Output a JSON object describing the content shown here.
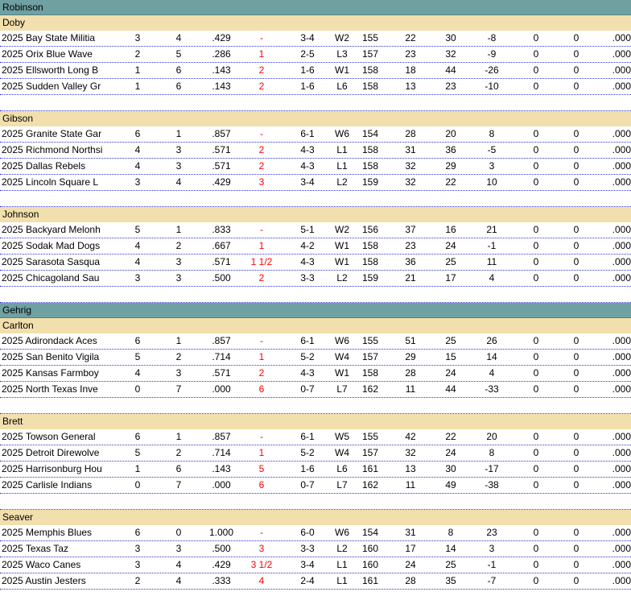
{
  "conferences": [
    {
      "name": "Robinson",
      "divisions": [
        {
          "name": "Doby",
          "teams": [
            {
              "team": "2025 Bay State Militia",
              "w": "3",
              "l": "4",
              "pct": ".429",
              "gb": "-",
              "div": "3-4",
              "strk": "W2",
              "rem": "155",
              "rf": "22",
              "ra": "30",
              "diff": "-8",
              "a": "0",
              "b": "0",
              "c": ".000"
            },
            {
              "team": "2025 Orix  Blue Wave",
              "w": "2",
              "l": "5",
              "pct": ".286",
              "gb": "1",
              "div": "2-5",
              "strk": "L3",
              "rem": "157",
              "rf": "23",
              "ra": "32",
              "diff": "-9",
              "a": "0",
              "b": "0",
              "c": ".000"
            },
            {
              "team": "2025 Ellsworth Long B",
              "w": "1",
              "l": "6",
              "pct": ".143",
              "gb": "2",
              "div": "1-6",
              "strk": "W1",
              "rem": "158",
              "rf": "18",
              "ra": "44",
              "diff": "-26",
              "a": "0",
              "b": "0",
              "c": ".000"
            },
            {
              "team": "2025 Sudden Valley Gr",
              "w": "1",
              "l": "6",
              "pct": ".143",
              "gb": "2",
              "div": "1-6",
              "strk": "L6",
              "rem": "158",
              "rf": "13",
              "ra": "23",
              "diff": "-10",
              "a": "0",
              "b": "0",
              "c": ".000"
            }
          ]
        },
        {
          "name": "Gibson",
          "teams": [
            {
              "team": "2025 Granite State Gar",
              "w": "6",
              "l": "1",
              "pct": ".857",
              "gb": "-",
              "div": "6-1",
              "strk": "W6",
              "rem": "154",
              "rf": "28",
              "ra": "20",
              "diff": "8",
              "a": "0",
              "b": "0",
              "c": ".000"
            },
            {
              "team": "2025 Richmond Northsi",
              "w": "4",
              "l": "3",
              "pct": ".571",
              "gb": "2",
              "div": "4-3",
              "strk": "L1",
              "rem": "158",
              "rf": "31",
              "ra": "36",
              "diff": "-5",
              "a": "0",
              "b": "0",
              "c": ".000"
            },
            {
              "team": "2025 Dallas Rebels",
              "w": "4",
              "l": "3",
              "pct": ".571",
              "gb": "2",
              "div": "4-3",
              "strk": "L1",
              "rem": "158",
              "rf": "32",
              "ra": "29",
              "diff": "3",
              "a": "0",
              "b": "0",
              "c": ".000"
            },
            {
              "team": "2025 Lincoln Square L",
              "w": "3",
              "l": "4",
              "pct": ".429",
              "gb": "3",
              "div": "3-4",
              "strk": "L2",
              "rem": "159",
              "rf": "32",
              "ra": "22",
              "diff": "10",
              "a": "0",
              "b": "0",
              "c": ".000"
            }
          ]
        },
        {
          "name": "Johnson",
          "teams": [
            {
              "team": "2025 Backyard Melonh",
              "w": "5",
              "l": "1",
              "pct": ".833",
              "gb": "-",
              "div": "5-1",
              "strk": "W2",
              "rem": "156",
              "rf": "37",
              "ra": "16",
              "diff": "21",
              "a": "0",
              "b": "0",
              "c": ".000"
            },
            {
              "team": "2025 Sodak Mad Dogs",
              "w": "4",
              "l": "2",
              "pct": ".667",
              "gb": "1",
              "div": "4-2",
              "strk": "W1",
              "rem": "158",
              "rf": "23",
              "ra": "24",
              "diff": "-1",
              "a": "0",
              "b": "0",
              "c": ".000"
            },
            {
              "team": "2025 Sarasota Sasqua",
              "w": "4",
              "l": "3",
              "pct": ".571",
              "gb": "1 1/2",
              "div": "4-3",
              "strk": "W1",
              "rem": "158",
              "rf": "36",
              "ra": "25",
              "diff": "11",
              "a": "0",
              "b": "0",
              "c": ".000"
            },
            {
              "team": "2025 Chicagoland Sau",
              "w": "3",
              "l": "3",
              "pct": ".500",
              "gb": "2",
              "div": "3-3",
              "strk": "L2",
              "rem": "159",
              "rf": "21",
              "ra": "17",
              "diff": "4",
              "a": "0",
              "b": "0",
              "c": ".000"
            }
          ]
        }
      ]
    },
    {
      "name": "Gehrig",
      "divisions": [
        {
          "name": "Carlton",
          "teams": [
            {
              "team": "2025 Adirondack Aces",
              "w": "6",
              "l": "1",
              "pct": ".857",
              "gb": "-",
              "div": "6-1",
              "strk": "W6",
              "rem": "155",
              "rf": "51",
              "ra": "25",
              "diff": "26",
              "a": "0",
              "b": "0",
              "c": ".000"
            },
            {
              "team": "2025 San Benito Vigila",
              "w": "5",
              "l": "2",
              "pct": ".714",
              "gb": "1",
              "div": "5-2",
              "strk": "W4",
              "rem": "157",
              "rf": "29",
              "ra": "15",
              "diff": "14",
              "a": "0",
              "b": "0",
              "c": ".000"
            },
            {
              "team": "2025 Kansas Farmboy",
              "w": "4",
              "l": "3",
              "pct": ".571",
              "gb": "2",
              "div": "4-3",
              "strk": "W1",
              "rem": "158",
              "rf": "28",
              "ra": "24",
              "diff": "4",
              "a": "0",
              "b": "0",
              "c": ".000"
            },
            {
              "team": "2025 North Texas Inve",
              "w": "0",
              "l": "7",
              "pct": ".000",
              "gb": "6",
              "div": "0-7",
              "strk": "L7",
              "rem": "162",
              "rf": "11",
              "ra": "44",
              "diff": "-33",
              "a": "0",
              "b": "0",
              "c": ".000"
            }
          ]
        },
        {
          "name": "Brett",
          "teams": [
            {
              "team": "2025 Towson  General",
              "w": "6",
              "l": "1",
              "pct": ".857",
              "gb": "-",
              "div": "6-1",
              "strk": "W5",
              "rem": "155",
              "rf": "42",
              "ra": "22",
              "diff": "20",
              "a": "0",
              "b": "0",
              "c": ".000"
            },
            {
              "team": "2025 Detroit Direwolve",
              "w": "5",
              "l": "2",
              "pct": ".714",
              "gb": "1",
              "div": "5-2",
              "strk": "W4",
              "rem": "157",
              "rf": "32",
              "ra": "24",
              "diff": "8",
              "a": "0",
              "b": "0",
              "c": ".000"
            },
            {
              "team": "2025 Harrisonburg Hou",
              "w": "1",
              "l": "6",
              "pct": ".143",
              "gb": "5",
              "div": "1-6",
              "strk": "L6",
              "rem": "161",
              "rf": "13",
              "ra": "30",
              "diff": "-17",
              "a": "0",
              "b": "0",
              "c": ".000"
            },
            {
              "team": "2025 Carlisle Indians",
              "w": "0",
              "l": "7",
              "pct": ".000",
              "gb": "6",
              "div": "0-7",
              "strk": "L7",
              "rem": "162",
              "rf": "11",
              "ra": "49",
              "diff": "-38",
              "a": "0",
              "b": "0",
              "c": ".000"
            }
          ]
        },
        {
          "name": "Seaver",
          "teams": [
            {
              "team": "2025 Memphis Blues",
              "w": "6",
              "l": "0",
              "pct": "1.000",
              "gb": "-",
              "div": "6-0",
              "strk": "W6",
              "rem": "154",
              "rf": "31",
              "ra": "8",
              "diff": "23",
              "a": "0",
              "b": "0",
              "c": ".000"
            },
            {
              "team": "2025 Texas Taz",
              "w": "3",
              "l": "3",
              "pct": ".500",
              "gb": "3",
              "div": "3-3",
              "strk": "L2",
              "rem": "160",
              "rf": "17",
              "ra": "14",
              "diff": "3",
              "a": "0",
              "b": "0",
              "c": ".000"
            },
            {
              "team": "2025 Waco Canes",
              "w": "3",
              "l": "4",
              "pct": ".429",
              "gb": "3 1/2",
              "div": "3-4",
              "strk": "L1",
              "rem": "160",
              "rf": "24",
              "ra": "25",
              "diff": "-1",
              "a": "0",
              "b": "0",
              "c": ".000"
            },
            {
              "team": "2025 Austin Jesters",
              "w": "2",
              "l": "4",
              "pct": ".333",
              "gb": "4",
              "div": "2-4",
              "strk": "L1",
              "rem": "161",
              "rf": "28",
              "ra": "35",
              "diff": "-7",
              "a": "0",
              "b": "0",
              "c": ".000"
            }
          ]
        }
      ]
    }
  ],
  "colors": {
    "conference_bg": "#6fa0a2",
    "division_bg": "#f2dfae",
    "games_behind": "#ff0000",
    "row_divider": "#3333cc"
  }
}
